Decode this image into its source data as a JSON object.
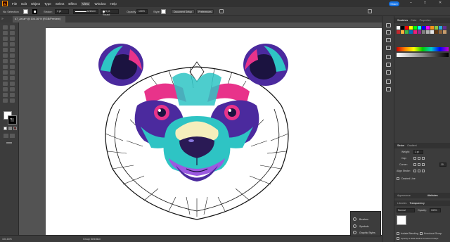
{
  "app": {
    "logo_text": "Ai",
    "share_label": "Share"
  },
  "menu": [
    "File",
    "Edit",
    "Object",
    "Type",
    "Select",
    "Effect",
    "View",
    "Window",
    "Help"
  ],
  "control_bar": {
    "selection": "No Selection",
    "stroke_label": "Stroke:",
    "stroke_value": "1 pt",
    "profile": "Uniform",
    "brush": "5 pt. Round",
    "opacity_label": "Opacity:",
    "opacity_value": "100%",
    "style_label": "Style:",
    "doc_setup": "Document Setup",
    "preferences": "Preferences"
  },
  "document": {
    "tab_title": "47_Art.ai* @ 104.16 % (RGB/Preview)"
  },
  "status_bar": {
    "zoom": "104.16%",
    "tool": "Group Selection"
  },
  "panels": {
    "top_tabs": [
      "Swatches",
      "Color",
      "Properties"
    ],
    "stroke_tabs": [
      "Stroke",
      "Gradient"
    ],
    "stroke": {
      "weight_label": "Weight:",
      "weight_value": "1 pt",
      "cap_label": "Cap:",
      "corner_label": "Corner:",
      "limit_value": "10",
      "align_label": "Align Stroke:",
      "dashed_label": "Dashed Line"
    },
    "transparency_tabs": [
      "Appearance",
      "Libraries",
      "Transparency"
    ],
    "transparency": {
      "blend_mode": "Normal",
      "opacity_label": "Opacity:",
      "opacity_value": "100%",
      "isolate_label": "Isolate Blending",
      "knockout_label": "Knockout Group",
      "opacity_mask_label": "Opacity & Mask Define Knockout Shape"
    },
    "attributes_tab": "Attributes"
  },
  "float_panel": {
    "items": [
      "Brushes",
      "Symbols",
      "Graphic Styles"
    ]
  },
  "swatch_colors": [
    "#ffffff",
    "#000000",
    "#ff0000",
    "#ffff00",
    "#00ff00",
    "#00ffff",
    "#0000ff",
    "#ff00ff",
    "#f7931e",
    "#8cc63f",
    "#29abe2",
    "#662d91",
    "#c1272d",
    "#fbb03b",
    "#39b54a",
    "#0071bc",
    "#ed1e79",
    "#93278f",
    "#808080",
    "#b3b3b3",
    "#e6e6e6",
    "#603813",
    "#8c6239",
    "#c69c6d"
  ],
  "art_colors": {
    "teal": "#2ec4c4",
    "purple": "#4b2a9e",
    "magenta": "#e8338a",
    "blue": "#2a4fd6",
    "cream": "#f5eebc",
    "dark": "#1b1340"
  }
}
